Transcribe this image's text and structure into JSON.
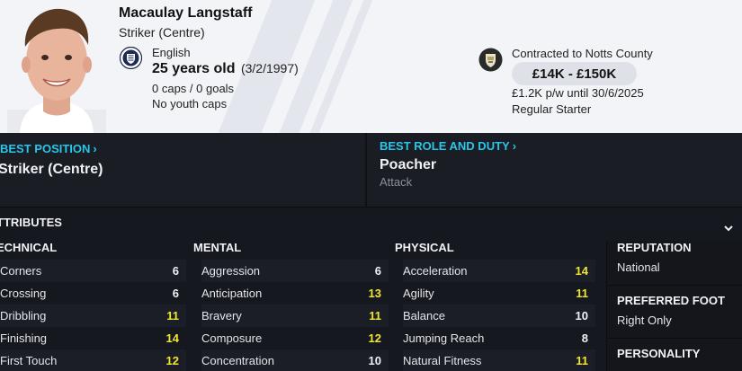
{
  "player": {
    "name": "Macaulay Langstaff",
    "position": "Striker (Centre)",
    "nationality": "English",
    "age": "25 years old",
    "dob": "(3/2/1997)",
    "caps": "0 caps / 0 goals",
    "youth": "No youth caps"
  },
  "contract": {
    "title": "Contracted to Notts County",
    "value": "£14K - £150K",
    "wage": "£1.2K p/w until 30/6/2025",
    "status": "Regular Starter"
  },
  "best_position": {
    "label": "BEST POSITION",
    "value": "Striker (Centre)"
  },
  "best_role": {
    "label": "BEST ROLE AND DUTY",
    "role": "Poacher",
    "duty": "Attack"
  },
  "attributes": {
    "title": "TTRIBUTES",
    "technical": {
      "heading": "ECHNICAL",
      "items": [
        {
          "name": "Corners",
          "value": "6"
        },
        {
          "name": "Crossing",
          "value": "6"
        },
        {
          "name": "Dribbling",
          "value": "11"
        },
        {
          "name": "Finishing",
          "value": "14"
        },
        {
          "name": "First Touch",
          "value": "12"
        }
      ]
    },
    "mental": {
      "heading": "MENTAL",
      "items": [
        {
          "name": "Aggression",
          "value": "6"
        },
        {
          "name": "Anticipation",
          "value": "13"
        },
        {
          "name": "Bravery",
          "value": "11"
        },
        {
          "name": "Composure",
          "value": "12"
        },
        {
          "name": "Concentration",
          "value": "10"
        }
      ]
    },
    "physical": {
      "heading": "PHYSICAL",
      "items": [
        {
          "name": "Acceleration",
          "value": "14"
        },
        {
          "name": "Agility",
          "value": "11"
        },
        {
          "name": "Balance",
          "value": "10"
        },
        {
          "name": "Jumping Reach",
          "value": "8"
        },
        {
          "name": "Natural Fitness",
          "value": "11"
        }
      ]
    }
  },
  "side_panel": {
    "reputation_label": "REPUTATION",
    "reputation": "National",
    "foot_label": "PREFERRED FOOT",
    "foot": "Right Only",
    "personality_label": "PERSONALITY"
  },
  "icons": {
    "collapse": "chevron-down-icon",
    "flag": "england-crest-icon",
    "club": "notts-county-crest-icon",
    "kicker_arrow": "chevron-right-icon"
  },
  "colors": {
    "accent": "#29c6ea",
    "highlight_value": "#f2e532",
    "header_bg": "#f3f4f7",
    "panel_bg": "#1a1d24"
  }
}
